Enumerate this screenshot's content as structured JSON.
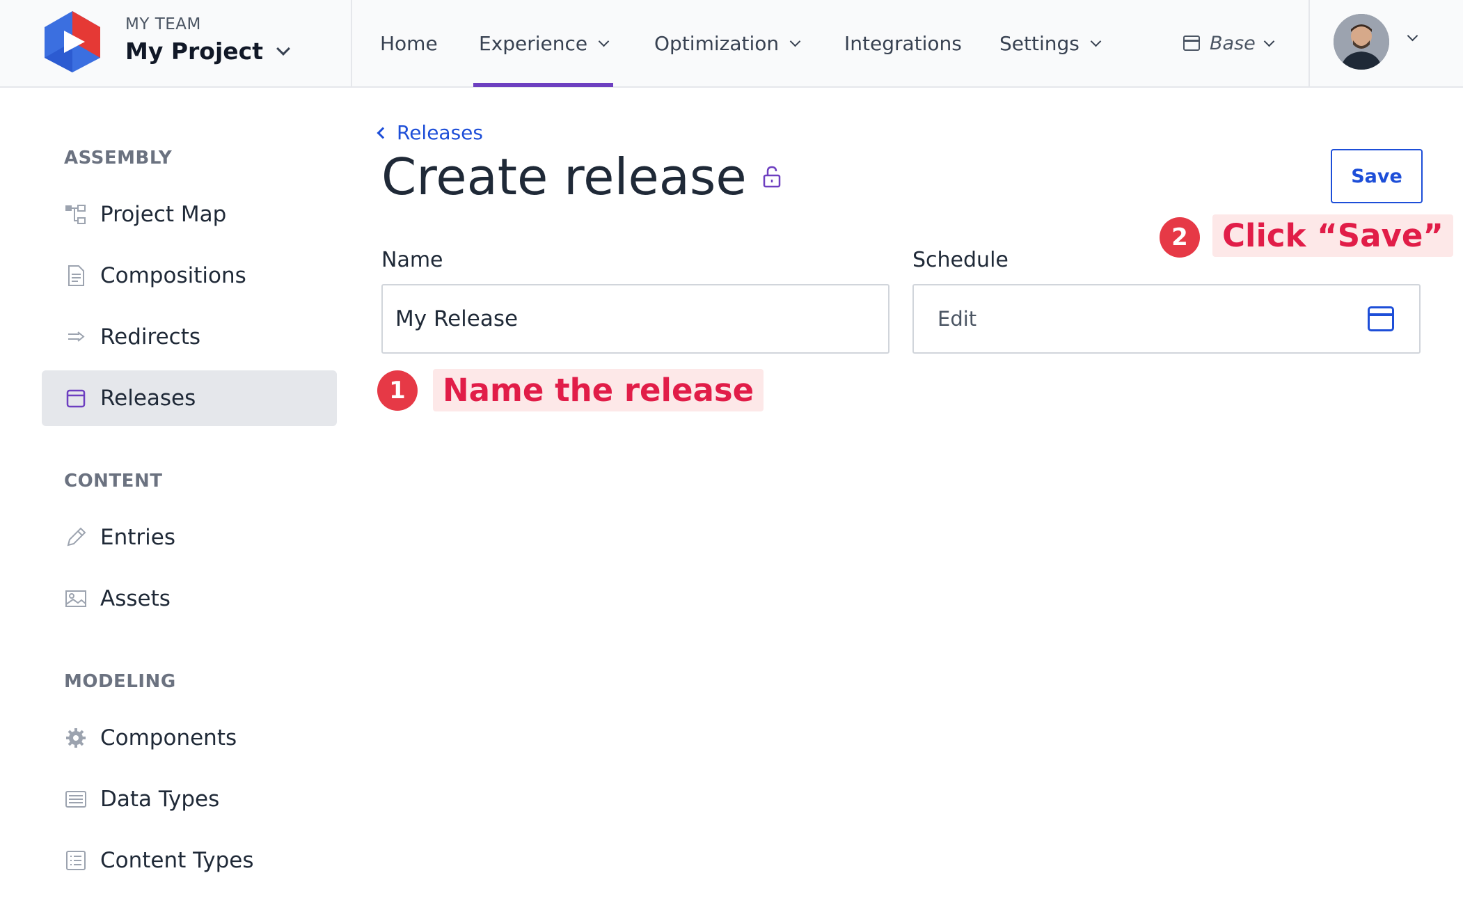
{
  "header": {
    "team": "MY TEAM",
    "project": "My Project",
    "nav": [
      {
        "label": "Home"
      },
      {
        "label": "Experience"
      },
      {
        "label": "Optimization"
      },
      {
        "label": "Integrations"
      },
      {
        "label": "Settings"
      }
    ],
    "environment": "Base"
  },
  "sidebar": {
    "sections": [
      {
        "title": "ASSEMBLY",
        "items": [
          {
            "label": "Project Map",
            "icon": "sitemap-icon"
          },
          {
            "label": "Compositions",
            "icon": "document-icon"
          },
          {
            "label": "Redirects",
            "icon": "redirect-arrow-icon"
          },
          {
            "label": "Releases",
            "icon": "calendar-icon",
            "active": true
          }
        ]
      },
      {
        "title": "CONTENT",
        "items": [
          {
            "label": "Entries",
            "icon": "pencil-icon"
          },
          {
            "label": "Assets",
            "icon": "image-icon"
          }
        ]
      },
      {
        "title": "MODELING",
        "items": [
          {
            "label": "Components",
            "icon": "gear-icon"
          },
          {
            "label": "Data Types",
            "icon": "list-box-icon"
          },
          {
            "label": "Content Types",
            "icon": "list-icon"
          }
        ]
      }
    ]
  },
  "main": {
    "breadcrumb": "Releases",
    "title": "Create release",
    "save_label": "Save",
    "name_label": "Name",
    "name_value": "My Release",
    "schedule_label": "Schedule",
    "schedule_value": "Edit"
  },
  "annotations": [
    {
      "number": "1",
      "text": "Name the release"
    },
    {
      "number": "2",
      "text": "Click “Save”"
    }
  ],
  "colors": {
    "accent": "#6d3fc0",
    "link": "#1d4ed8",
    "annotation": "#e63946"
  }
}
